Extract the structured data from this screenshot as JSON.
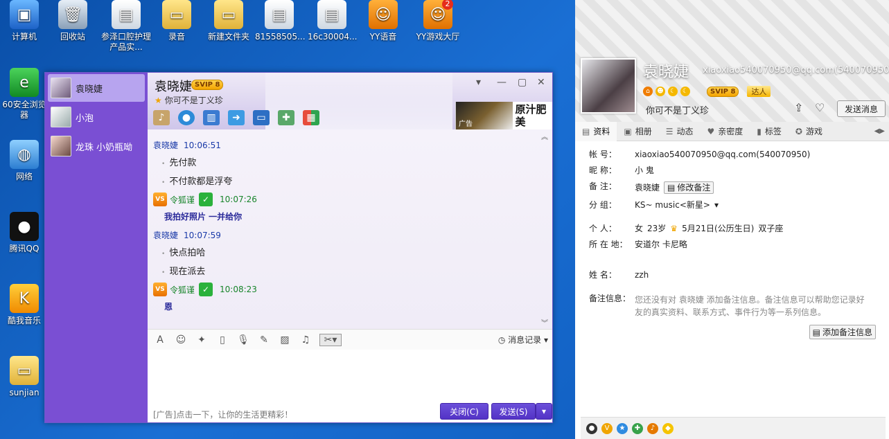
{
  "desktop": {
    "icons": [
      {
        "label": "计算机",
        "glyph": "▣"
      },
      {
        "label": "回收站",
        "glyph": "🗑"
      },
      {
        "label": "参泽口腔护理产品实...",
        "glyph": "▤"
      },
      {
        "label": "录音",
        "glyph": "▭"
      },
      {
        "label": "新建文件夹",
        "glyph": "▭"
      },
      {
        "label": "81558505...",
        "glyph": "▤"
      },
      {
        "label": "16c30004...",
        "glyph": "▤"
      },
      {
        "label": "YY语音",
        "glyph": "☺"
      },
      {
        "label": "YY游戏大厅",
        "glyph": "☺",
        "badge": "2"
      },
      {
        "label": "60安全浏览器",
        "glyph": "e"
      },
      {
        "label": "网络",
        "glyph": "◍"
      },
      {
        "label": "腾讯QQ",
        "glyph": "●"
      },
      {
        "label": "酷我音乐",
        "glyph": "K"
      },
      {
        "label": "sunjian",
        "glyph": "▭"
      }
    ]
  },
  "chat": {
    "contacts": [
      {
        "name": "袁晓婕"
      },
      {
        "name": "小泡"
      },
      {
        "name": "龙珠  小奶瓶呦"
      }
    ],
    "title": "袁晓婕",
    "vip": "SVIP 8",
    "signature": "你可不是丁义珍",
    "ad_label": "广告",
    "ad_text": "原汁肥美",
    "messages": {
      "m1_name": "袁晓婕",
      "m1_time": "10:06:51",
      "m1_l1": "先付款",
      "m1_l2": "不付款都是浮夸",
      "s1_name": "令狐谨",
      "s1_time": "10:07:26",
      "s1_text": "我拍好照片 一并给你",
      "m2_name": "袁晓婕",
      "m2_time": "10:07:59",
      "m2_l1": "快点拍哈",
      "m2_l2": "现在派去",
      "s2_name": "令狐谨",
      "s2_time": "10:08:23",
      "s2_text": "恩"
    },
    "history_label": "消息记录",
    "footer_ad": "[广告]点击一下，让你的生活更精彩！",
    "close_label": "关闭(C)",
    "send_label": "发送(S)"
  },
  "profile": {
    "name": "袁晓婕",
    "account_header": "xiaoxiao540070950@qq.com(540070950",
    "vip": "SVIP 8",
    "daren": "达人",
    "signature": "你可不是丁义珍",
    "send_msg": "发送消息",
    "tabs": [
      "资料",
      "相册",
      "动态",
      "亲密度",
      "标签",
      "游戏"
    ],
    "fields": {
      "acct_k": "帐    号：",
      "acct_v": "xiaoxiao540070950@qq.com(540070950)",
      "nick_k": "昵    称：",
      "nick_v": "小 鬼",
      "remark_k": "备    注：",
      "remark_v": "袁晓婕",
      "remark_btn": "修改备注",
      "group_k": "分    组：",
      "group_v": "KS~ music<新星>",
      "personal_k": "个    人：",
      "gender": "女",
      "age": "23岁",
      "birthday": "5月21日(公历生日)",
      "zodiac": "双子座",
      "loc_k": "所 在 地：",
      "loc_v": "安道尔 卡尼略",
      "realname_k": "姓    名：",
      "realname_v": "zzh",
      "note_k": "备注信息：",
      "note_v": "您还没有对 袁晓婕 添加备注信息。备注信息可以帮助您记录好友的真实资料、联系方式、事件行为等一系列信息。",
      "add_note_btn": "添加备注信息"
    }
  },
  "colors": {
    "accent": "#5a3fcf",
    "contact_bg": "#7a4fd3",
    "self_name": "#17842a"
  }
}
